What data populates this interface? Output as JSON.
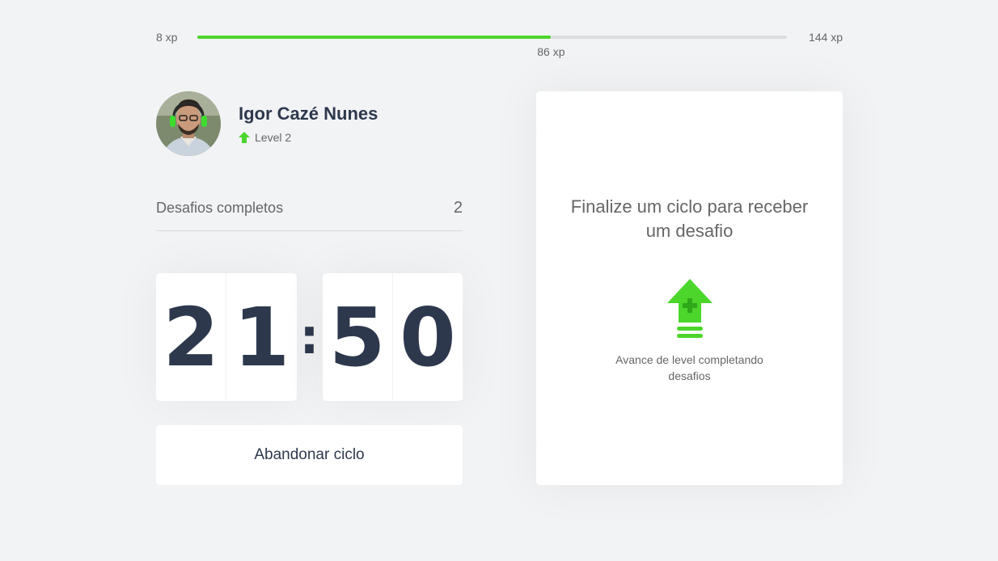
{
  "xp": {
    "min_label": "8 xp",
    "max_label": "144 xp",
    "current_label": "86 xp",
    "progress_percent": 60,
    "accent_color": "#4cd62b"
  },
  "profile": {
    "name": "Igor Cazé Nunes",
    "level_label": "Level 2",
    "level_icon": "level-up-arrow-icon"
  },
  "completed_challenges": {
    "label": "Desafios completos",
    "count": "2"
  },
  "countdown": {
    "minute_tens": "2",
    "minute_ones": "1",
    "separator": ":",
    "second_tens": "5",
    "second_ones": "0"
  },
  "abandon_button": {
    "label": "Abandonar ciclo"
  },
  "challenge_box": {
    "title": "Finalize um ciclo para receber um desafio",
    "hint": "Avance de level completando desafios",
    "icon": "level-up-icon"
  }
}
